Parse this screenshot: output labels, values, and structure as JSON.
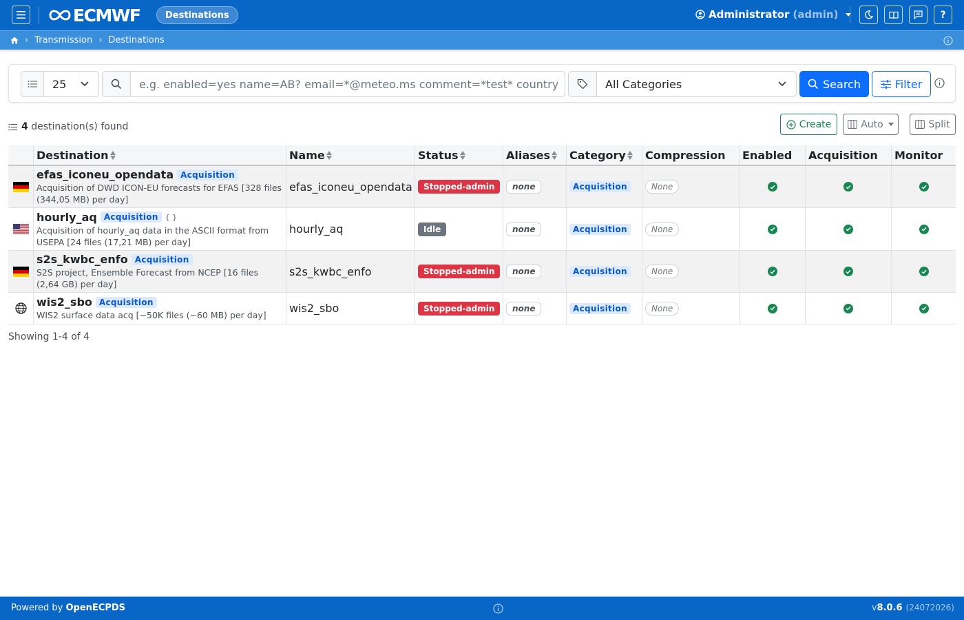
{
  "navbar": {
    "brand": "ECMWF",
    "page_pill": "Destinations",
    "user_name": "Administrator",
    "user_login": "(admin)"
  },
  "breadcrumb": {
    "items": [
      "Transmission",
      "Destinations"
    ]
  },
  "search": {
    "page_size": "25",
    "placeholder": "e.g. enabled=yes name=AB? email=*@meteo.ms comment=*test* country=fr",
    "category_selected": "All Categories",
    "search_label": "Search",
    "filter_label": "Filter"
  },
  "results": {
    "count": "4",
    "count_label": "destination(s) found",
    "create_label": "Create",
    "auto_label": "Auto",
    "split_label": "Split",
    "showing": "Showing 1-4 of 4"
  },
  "table": {
    "columns": [
      "Destination",
      "Name",
      "Status",
      "Aliases",
      "Category",
      "Compression",
      "Enabled",
      "Acquisition",
      "Monitor"
    ],
    "rows": [
      {
        "flag": "de-flag-icon",
        "destination": "efas_iconeu_opendata",
        "tag": "Acquisition",
        "description": "Acquisition of DWD ICON-EU forecasts for EFAS [328 files (344,05 MB) per day]",
        "name": "efas_iconeu_opendata",
        "status": "Stopped-admin",
        "aliases": "none",
        "category": "Acquisition",
        "compression": "None"
      },
      {
        "flag": "us-flag-icon",
        "destination": "hourly_aq",
        "tag": "Acquisition",
        "extra": "{ }",
        "description": "Acquisition of hourly_aq data in the ASCII format from USEPA [24 files (17,21 MB) per day]",
        "name": "hourly_aq",
        "status": "Idle",
        "aliases": "none",
        "category": "Acquisition",
        "compression": "None"
      },
      {
        "flag": "de-flag-icon",
        "destination": "s2s_kwbc_enfo",
        "tag": "Acquisition",
        "description": "S2S project, Ensemble Forecast from NCEP [16 files (2,64 GB) per day]",
        "name": "s2s_kwbc_enfo",
        "status": "Stopped-admin",
        "aliases": "none",
        "category": "Acquisition",
        "compression": "None"
      },
      {
        "flag": "globe-icon",
        "destination": "wis2_sbo",
        "tag": "Acquisition",
        "description": "WIS2 surface data acq [~50K files (~60 MB) per day]",
        "name": "wis2_sbo",
        "status": "Stopped-admin",
        "aliases": "none",
        "category": "Acquisition",
        "compression": "None"
      }
    ]
  },
  "footer": {
    "powered_prefix": "Powered by",
    "powered_name": "OpenECPDS",
    "version_prefix": "v",
    "version": "8.0.6",
    "build": "(24072026)"
  },
  "colors": {
    "primary": "#0866c6",
    "danger": "#dc3545",
    "success": "#198754",
    "secondary": "#6c757d"
  }
}
